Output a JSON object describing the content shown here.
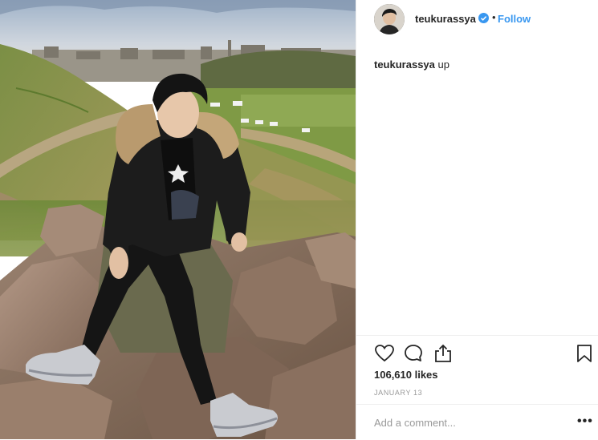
{
  "post": {
    "username": "teukurassya",
    "follow_label": "Follow",
    "dot": "•",
    "caption_text": "up",
    "likes": "106,610 likes",
    "date": "JANUARY 13",
    "comment_placeholder": "Add a comment...",
    "more_label": "•••"
  },
  "icons": {
    "verified": "verified-badge-icon",
    "like": "heart-icon",
    "comment": "speech-bubble-icon",
    "share": "share-upload-icon",
    "save": "bookmark-icon"
  },
  "colors": {
    "accent": "#3897f0",
    "text": "#262626",
    "muted": "#999999",
    "border": "#efefef"
  }
}
